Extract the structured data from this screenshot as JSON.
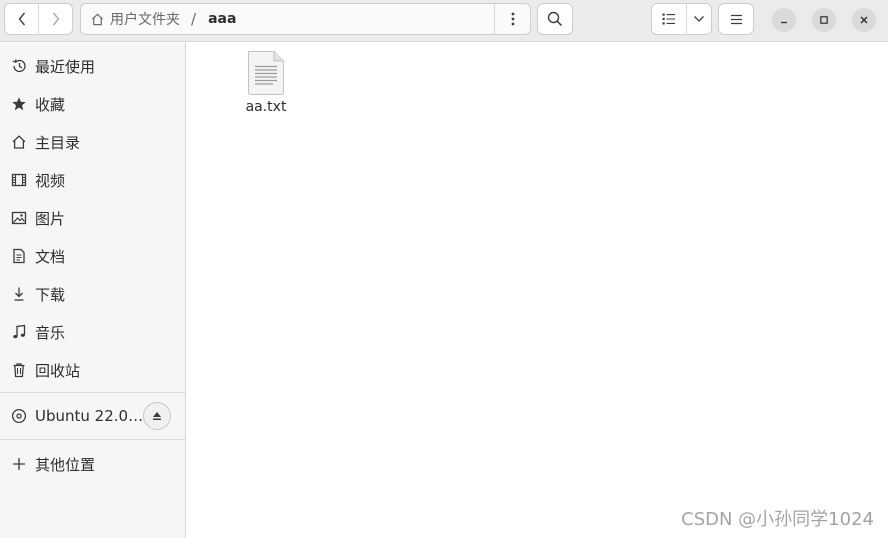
{
  "header": {
    "path": {
      "home_label": "用户文件夹",
      "separator": "/",
      "current": "aaa"
    }
  },
  "sidebar": {
    "items": [
      {
        "label": "最近使用",
        "icon": "recent-icon"
      },
      {
        "label": "收藏",
        "icon": "star-icon"
      },
      {
        "label": "主目录",
        "icon": "home-icon"
      },
      {
        "label": "视频",
        "icon": "video-icon"
      },
      {
        "label": "图片",
        "icon": "picture-icon"
      },
      {
        "label": "文档",
        "icon": "document-icon"
      },
      {
        "label": "下载",
        "icon": "download-icon"
      },
      {
        "label": "音乐",
        "icon": "music-icon"
      },
      {
        "label": "回收站",
        "icon": "trash-icon"
      }
    ],
    "device": {
      "label": "Ubuntu 22.0…",
      "icon": "disc-icon"
    },
    "other": {
      "label": "其他位置",
      "icon": "plus-icon"
    }
  },
  "content": {
    "files": [
      {
        "name": "aa.txt",
        "icon": "text-file-icon"
      }
    ]
  },
  "watermark": "CSDN @小孙同学1024"
}
